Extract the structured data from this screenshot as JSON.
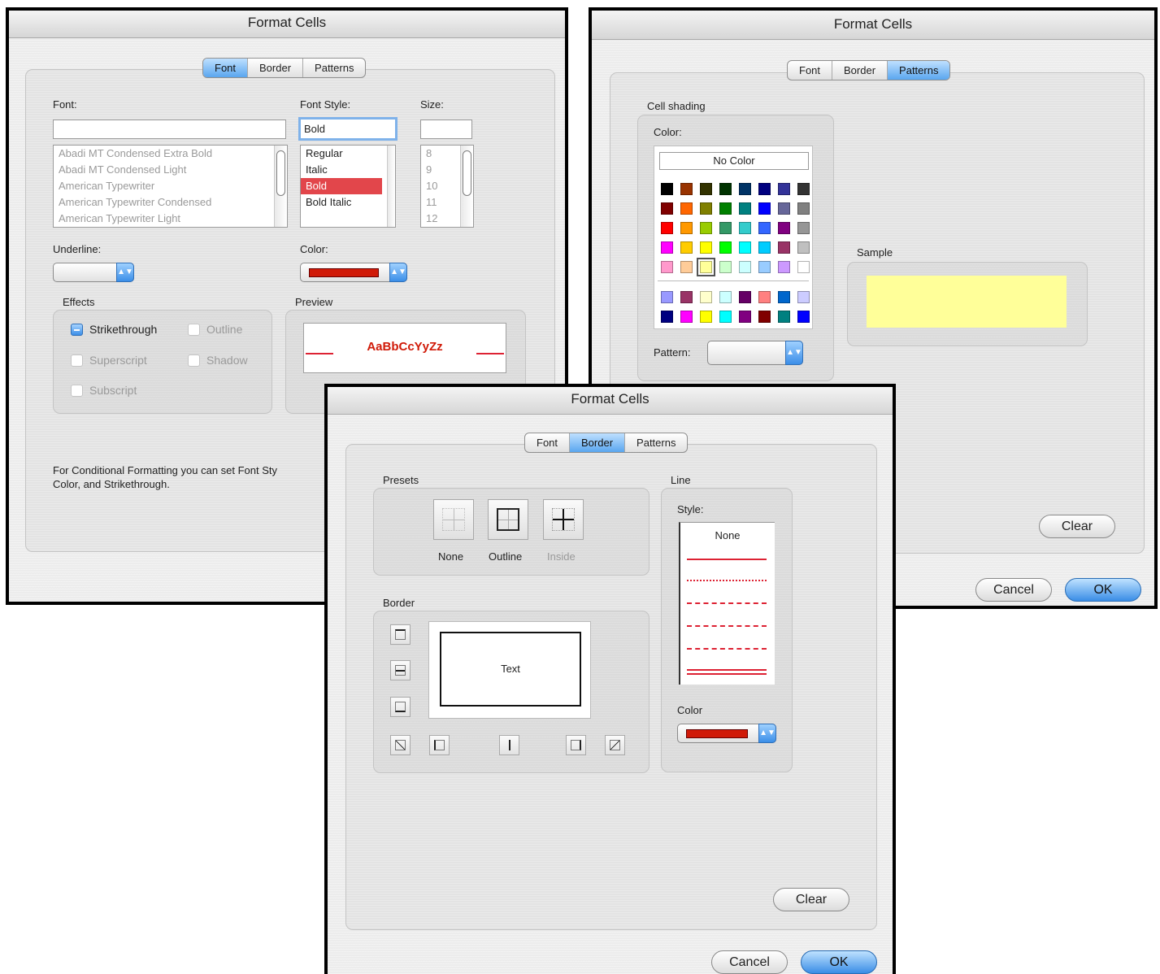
{
  "dialog_font": {
    "title": "Format Cells",
    "tabs": [
      "Font",
      "Border",
      "Patterns"
    ],
    "selected_tab": "Font",
    "font_label": "Font:",
    "font_value": "",
    "font_list": [
      "Abadi MT Condensed Extra Bold",
      "Abadi MT Condensed Light",
      "American Typewriter",
      "American Typewriter Condensed",
      "American Typewriter Light"
    ],
    "style_label": "Font Style:",
    "style_value": "Bold",
    "style_list": [
      "Regular",
      "Italic",
      "Bold",
      "Bold Italic"
    ],
    "style_selected": "Bold",
    "size_label": "Size:",
    "size_value": "",
    "size_list": [
      "8",
      "9",
      "10",
      "11",
      "12"
    ],
    "underline_label": "Underline:",
    "color_label": "Color:",
    "color_value": "#d01a08",
    "effects_label": "Effects",
    "effects": {
      "strikethrough": "Strikethrough",
      "outline": "Outline",
      "superscript": "Superscript",
      "shadow": "Shadow",
      "subscript": "Subscript"
    },
    "strikethrough_checked": true,
    "preview_label": "Preview",
    "preview_text": "AaBbCcYyZz",
    "preview_color": "#d01a08",
    "note_line1": "For Conditional Formatting you can set Font Sty",
    "note_line2": "Color, and Strikethrough."
  },
  "dialog_patterns": {
    "title": "Format Cells",
    "tabs": [
      "Font",
      "Border",
      "Patterns"
    ],
    "selected_tab": "Patterns",
    "cell_shading_label": "Cell shading",
    "color_label": "Color:",
    "no_color_label": "No Color",
    "palette_rows": [
      [
        "#000000",
        "#993300",
        "#333300",
        "#003300",
        "#003366",
        "#000080",
        "#333399",
        "#333333"
      ],
      [
        "#800000",
        "#ff6600",
        "#808000",
        "#008000",
        "#008080",
        "#0000ff",
        "#666699",
        "#808080"
      ],
      [
        "#ff0000",
        "#ff9900",
        "#99cc00",
        "#339966",
        "#33cccc",
        "#3366ff",
        "#800080",
        "#969696"
      ],
      [
        "#ff00ff",
        "#ffcc00",
        "#ffff00",
        "#00ff00",
        "#00ffff",
        "#00ccff",
        "#993366",
        "#c0c0c0"
      ],
      [
        "#ff99cc",
        "#ffcc99",
        "#ffff99",
        "#ccffcc",
        "#ccffff",
        "#99ccff",
        "#cc99ff",
        "#ffffff"
      ]
    ],
    "palette_extra_rows": [
      [
        "#9999ff",
        "#993366",
        "#ffffcc",
        "#ccffff",
        "#660066",
        "#ff8080",
        "#0066cc",
        "#ccccff"
      ],
      [
        "#000080",
        "#ff00ff",
        "#ffff00",
        "#00ffff",
        "#800080",
        "#800000",
        "#008080",
        "#0000ff"
      ]
    ],
    "selected_color": "#ffff99",
    "pattern_label": "Pattern:",
    "sample_label": "Sample",
    "sample_color": "#ffff99",
    "clear_label": "Clear",
    "cancel_label": "Cancel",
    "ok_label": "OK"
  },
  "dialog_border": {
    "title": "Format Cells",
    "tabs": [
      "Font",
      "Border",
      "Patterns"
    ],
    "selected_tab": "Border",
    "presets_label": "Presets",
    "presets": [
      "None",
      "Outline",
      "Inside"
    ],
    "border_label": "Border",
    "preview_text": "Text",
    "line_label": "Line",
    "style_label": "Style:",
    "style_none": "None",
    "line_color_label": "Color",
    "line_color": "#d01a08",
    "clear_label": "Clear",
    "cancel_label": "Cancel",
    "ok_label": "OK"
  }
}
